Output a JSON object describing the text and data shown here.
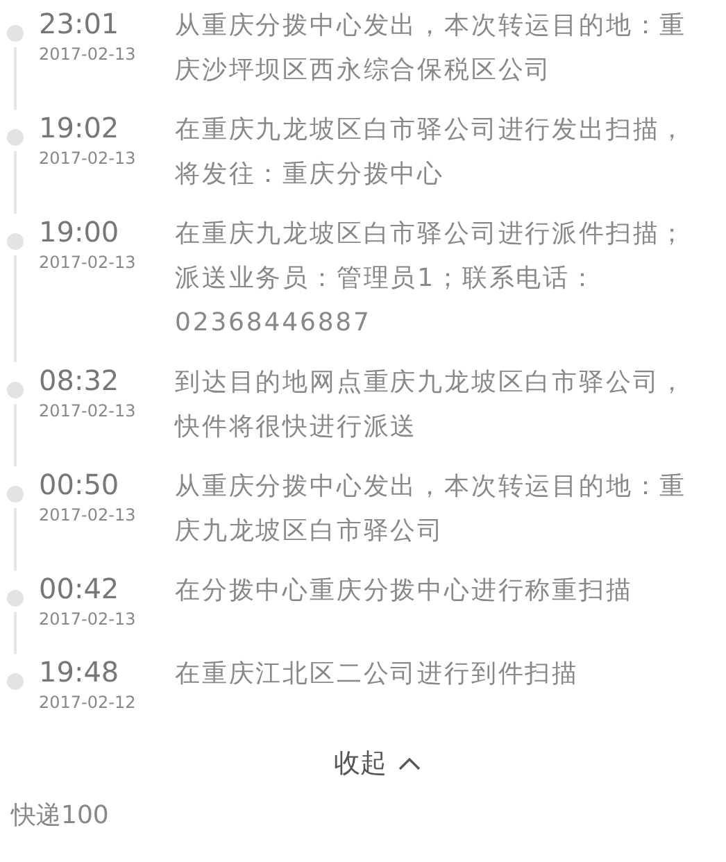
{
  "events": [
    {
      "time": "23:01",
      "date": "2017-02-13",
      "text": "从重庆分拨中心发出，本次转运目的地：重庆沙坪坝区西永综合保税区公司"
    },
    {
      "time": "19:02",
      "date": "2017-02-13",
      "text": "在重庆九龙坡区白市驿公司进行发出扫描，将发往：重庆分拨中心"
    },
    {
      "time": "19:00",
      "date": "2017-02-13",
      "text": "在重庆九龙坡区白市驿公司进行派件扫描；派送业务员：管理员1；联系电话：02368446887"
    },
    {
      "time": "08:32",
      "date": "2017-02-13",
      "text": "到达目的地网点重庆九龙坡区白市驿公司，快件将很快进行派送"
    },
    {
      "time": "00:50",
      "date": "2017-02-13",
      "text": "从重庆分拨中心发出，本次转运目的地：重庆九龙坡区白市驿公司"
    },
    {
      "time": "00:42",
      "date": "2017-02-13",
      "text": "在分拨中心重庆分拨中心进行称重扫描"
    },
    {
      "time": "19:48",
      "date": "2017-02-12",
      "text": "在重庆江北区二公司进行到件扫描"
    }
  ],
  "collapse_button": {
    "label": "收起"
  },
  "footer": {
    "brand": "快递100"
  }
}
